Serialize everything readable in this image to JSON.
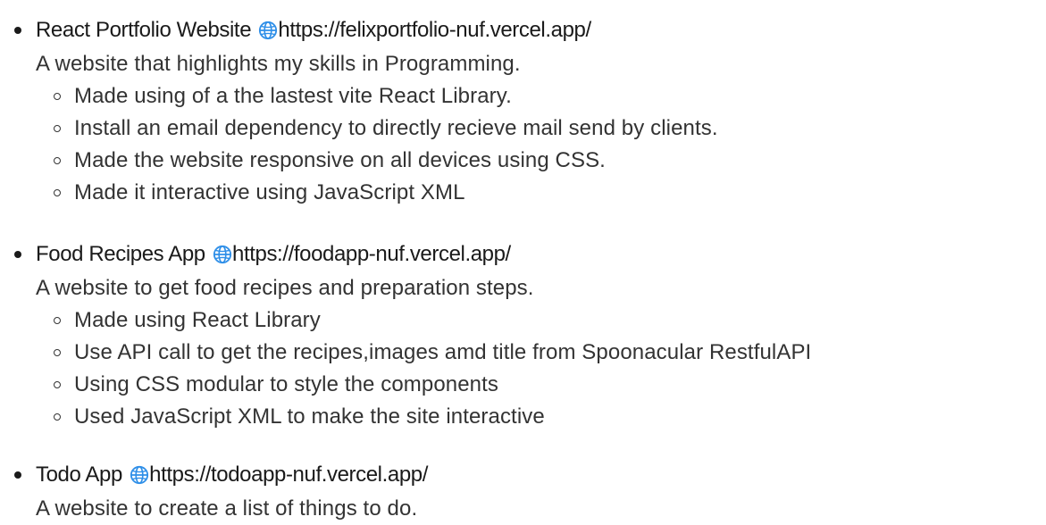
{
  "accent_color": "#2f8fe8",
  "projects": [
    {
      "title": "React Portfolio Website",
      "icon": "globe-icon",
      "url": "https://felixportfolio-nuf.vercel.app/",
      "description": "A website that highlights my skills in Programming.",
      "points": [
        "Made using of  a the lastest vite React Library.",
        "Install an email dependency to directly recieve mail send by clients.",
        "Made the website responsive on all devices using CSS.",
        "Made it interactive using JavaScript XML"
      ]
    },
    {
      "title": "Food Recipes App",
      "icon": "globe-icon",
      "url": "https://foodapp-nuf.vercel.app/",
      "description": "A website to get food recipes and preparation steps.",
      "points": [
        "Made using React Library",
        "Use  API call to get the recipes,images amd title from Spoonacular RestfulAPI",
        "Using CSS modular to style the components",
        "Used JavaScript XML to make the site interactive"
      ]
    },
    {
      "title": "Todo App",
      "icon": "globe-icon",
      "url": "https://todoapp-nuf.vercel.app/",
      "description": "A website to create a list of things to do."
    }
  ]
}
